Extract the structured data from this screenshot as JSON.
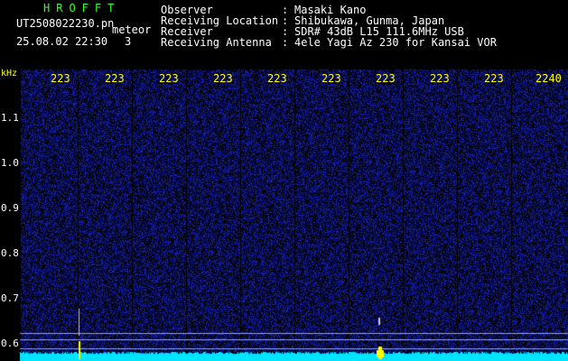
{
  "header": {
    "brand": "HROFFT",
    "filename": "UT2508022230.pn",
    "meteor_label": "meteor",
    "datetime": "25.08.02 22:30",
    "meteor_count": "3",
    "fields": [
      {
        "label": "Observer",
        "value": "Masaki Kano"
      },
      {
        "label": "Receiving Location",
        "value": "Shibukawa, Gunma, Japan"
      },
      {
        "label": "Receiver",
        "value": "SDR# 43dB L15 111.6MHz USB"
      },
      {
        "label": "Receiving Antenna",
        "value": "4ele Yagi Az 230 for Kansai VOR"
      }
    ]
  },
  "axis": {
    "y_unit": "kHz",
    "y_ticks": [
      "1.1",
      "1.0",
      "0.9",
      "0.8",
      "0.7",
      "0.6"
    ],
    "x_ticks": [
      "223",
      "223",
      "223",
      "223",
      "223",
      "223",
      "223",
      "223",
      "223",
      "2240"
    ]
  },
  "colors": {
    "background": "#000000",
    "noise": "#1a2aa8",
    "trace": "#00e5ff",
    "meteor": "#ffff00",
    "header_text": "#ffffff",
    "brand": "#33ff33",
    "ticks": "#ffff00"
  }
}
